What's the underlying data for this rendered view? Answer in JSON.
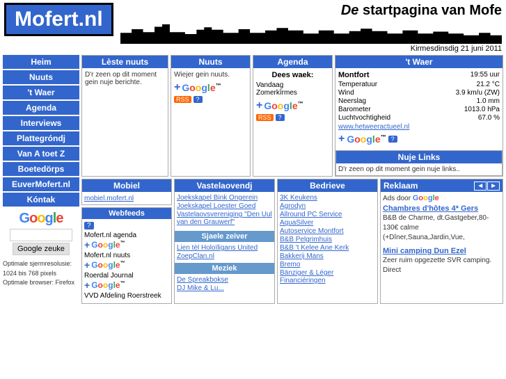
{
  "header": {
    "logo": "Mofert.nl",
    "tagline_de": "De",
    "tagline_rest": " startpagina van Mofe",
    "date": "Kirmesdinsdig 21 juni 2011"
  },
  "nav": {
    "items": [
      "Heim",
      "Nuuts",
      "'t Waer",
      "Agenda",
      "Interviews",
      "Plattegróndj",
      "Van A toet Z",
      "Boetedörps",
      "EuverMofert.nl",
      "Kóntak"
    ],
    "google_search_placeholder": "",
    "google_btn_label": "Google zeuke",
    "optimal_label": "Optimale sjermresolusie:",
    "optimal_res": "1024 bis 768 pixels",
    "optimal_browser": "Optimale browser: Firefox"
  },
  "leste_nuuts": {
    "header": "Lèste nuuts",
    "content": "D'r zeen op dit moment gein nuje berichte."
  },
  "nuuts": {
    "header": "Nuuts",
    "content": "Wiejer gein nuuts."
  },
  "agenda": {
    "header": "Agenda",
    "dees_waek": "Dees waek:",
    "items": [
      "Vandaag",
      "Zomerkîrmes"
    ]
  },
  "waer": {
    "header": "'t Waer",
    "city": "Montfort",
    "time": "19:55 uur",
    "rows": [
      {
        "label": "Temperatuur",
        "value": "21.2 °C"
      },
      {
        "label": "Wind",
        "value": "3.9 km/u (ZW)"
      },
      {
        "label": "Neerslag",
        "value": "1.0 mm"
      },
      {
        "label": "Barometer",
        "value": "1013.0 hPa"
      },
      {
        "label": "Luchtvochtigheid",
        "value": "67.0 %"
      }
    ],
    "link": "www.hetweeractueel.nl"
  },
  "nuje_links": {
    "header": "Nuje Links",
    "content": "D'r zeen op dit moment gein nuje links.."
  },
  "mobiel": {
    "header": "Mobiel",
    "link": "mobiel.mofert.nl",
    "webfeeds_header": "Webfeeds",
    "question": "?",
    "feeds": [
      {
        "label": "Mofert.nl agenda"
      },
      {
        "label": "Mofert.nl nuuts"
      },
      {
        "label": "Roerdal Journal"
      },
      {
        "label": "VVD Afdeling Roerstreek"
      }
    ]
  },
  "vastela": {
    "header": "Vastelaovendj",
    "items": [
      "Joekskapel Bink Ongerein",
      "Joekskapel Loester Goed",
      "Vastelaovsvereniging \"Den Uul van den Grauwerf\"",
      "Sjaele zeiver",
      "Lien tèl Holoïligans United",
      "ZoepClan.nl",
      "Meziek",
      "De Spreakbokse",
      "DJ Mike & Lu..."
    ],
    "sjaele_header": "Sjaele zeiver",
    "meziek_header": "Meziek"
  },
  "bedrieve": {
    "header": "Bedrieve",
    "items": [
      "3K Keukens",
      "Agrodyn",
      "Allround PC Service",
      "AquaSilver",
      "Autoservice Montfort",
      "B&B Pelgrimhuis",
      "B&B 't Kelee Ane Kerk",
      "Bakkerij Mans",
      "Bremo",
      "Bänziger & Léger Financiéringen"
    ]
  },
  "reklaam": {
    "header": "Reklaam",
    "ads_text": "Ads door Google",
    "items": [
      {
        "title": "Chambres d'hôtes 4* Gers",
        "text": "B&B de Charme, dt.Gastgeber,80-130€ calme (+Dîner,Sauna,Jardin,Vue,"
      },
      {
        "title": "Mini camping Dun Ezel",
        "text": "Zeer ruim opgezette SVR camping. Direct"
      }
    ]
  }
}
